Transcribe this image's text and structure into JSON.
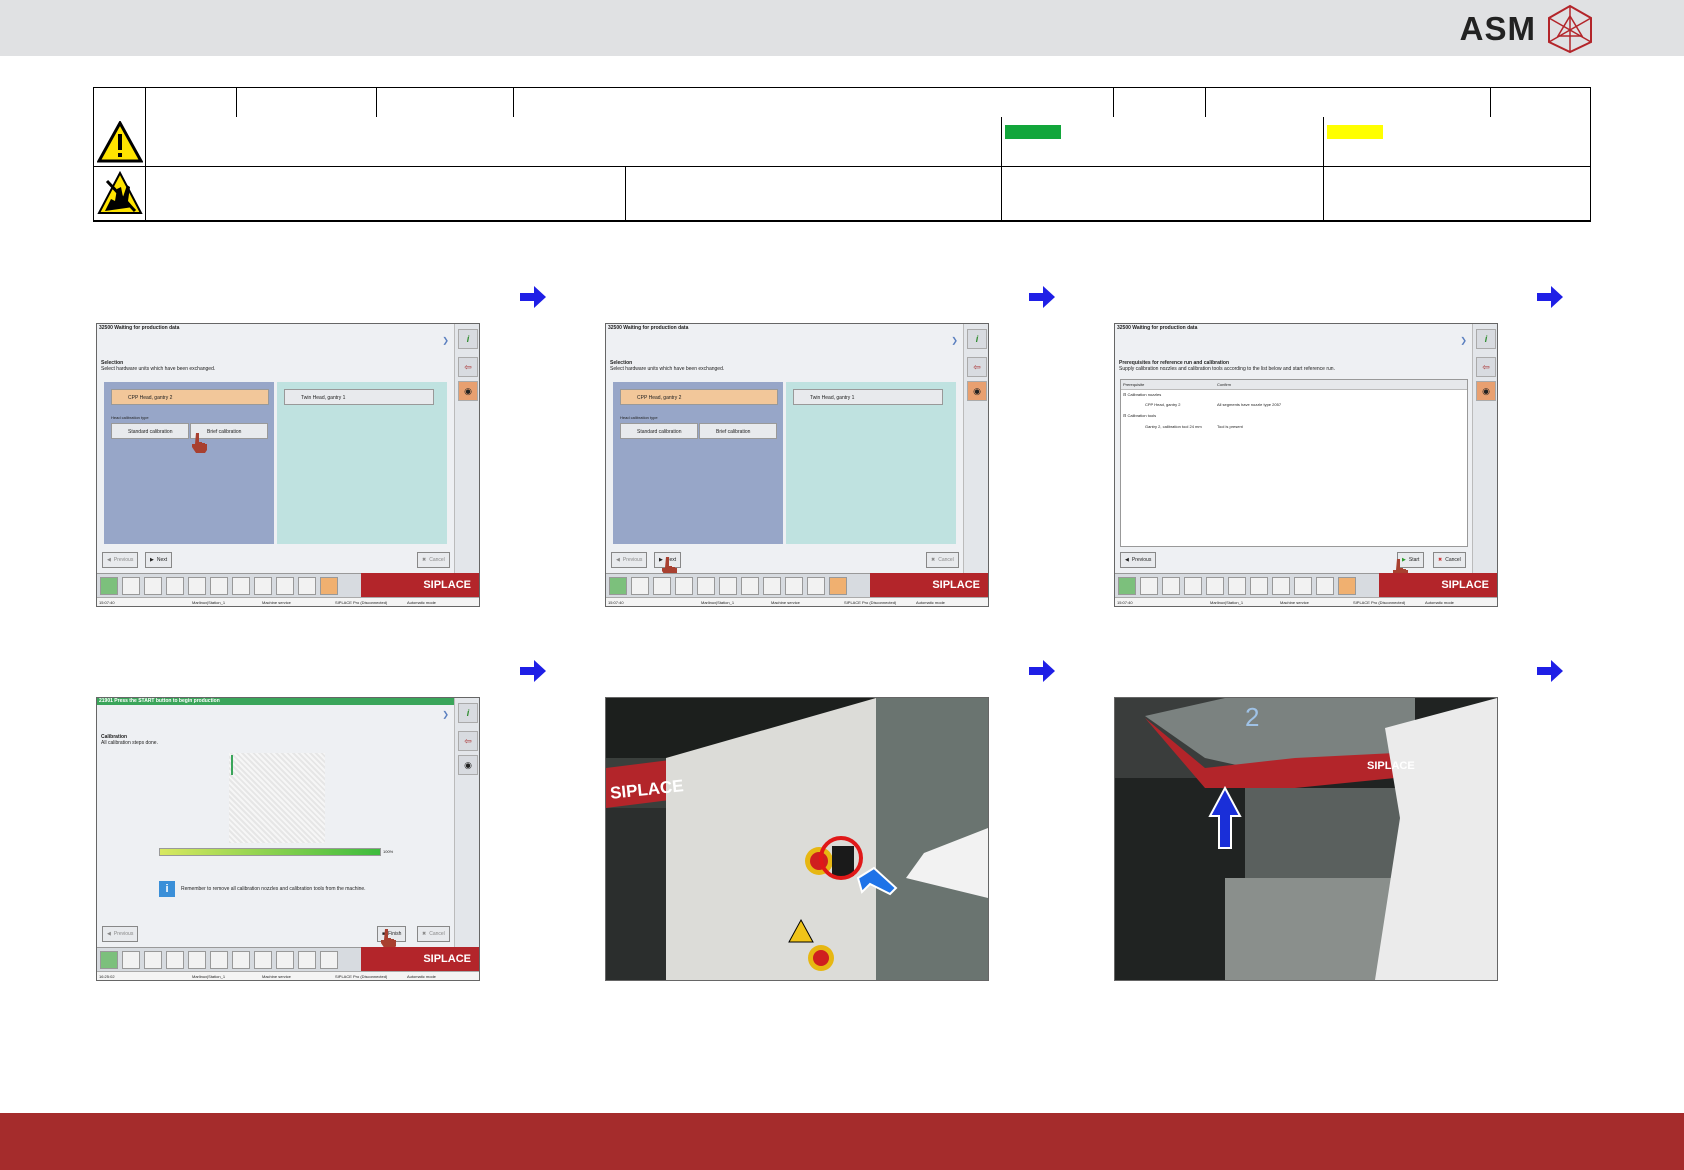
{
  "header": {
    "logo_text": "ASM"
  },
  "colors": {
    "header_bg": "#e0e1e3",
    "footer_bg": "#a52c2c",
    "brand_red": "#b3252a",
    "arrow_blue": "#1f1fe6",
    "swatch_green": "#12a63b",
    "swatch_yellow": "#ffff00"
  },
  "info_table": {
    "warning_icon": "warning-triangle-icon",
    "esd_icon": "esd-hand-icon"
  },
  "screens": {
    "s1": {
      "title": "32500 Waiting for production data",
      "section_title": "Selection",
      "section_text": "Select hardware units which have been exchanged.",
      "left_unit": "CPP Head, gantry 2",
      "right_unit": "Twin Head, gantry 1",
      "calib_label": "Head calibration type",
      "standard": "Standard calibration",
      "brief": "Brief calibration",
      "prev": "Previous",
      "next": "Next",
      "cancel": "Cancel"
    },
    "s3": {
      "title": "32500 Waiting for production data",
      "section_title": "Prerequisites for reference run and calibration",
      "section_text": "Supply calibration nozzles and calibration tools according to the list below and start reference run.",
      "col_prereq": "Prerequisite",
      "col_confirm": "Confirm",
      "group1": "Calibration nozzles",
      "row1_item": "CPP Head, gantry 2",
      "row1_confirm": "All segments have nozzle type 2057",
      "group2": "Calibration tools",
      "row2_item": "Gantry 2, calibration tool 24 mm",
      "row2_confirm": "Tool is present",
      "prev": "Previous",
      "start": "Start",
      "cancel": "Cancel"
    },
    "s4": {
      "title": "21901 Press the START button to begin production",
      "section_title": "Calibration",
      "section_text": "All calibration steps done.",
      "progress": 100,
      "progress_label": "100%",
      "hint": "Remember to remove all calibration nozzles and calibration tools from the machine.",
      "prev": "Previous",
      "finish": "Finish",
      "cancel": "Cancel"
    },
    "brand": "SIPLACE",
    "status": {
      "time1": "15:07:40",
      "time4": "16:25:02",
      "line": "Marlinux|Station_1",
      "service": "Machine service",
      "pro": "SIPLACE Pro (Disconnected)",
      "mode": "Automatic mode"
    }
  },
  "photos": {
    "p5_label": "SIPLACE",
    "p6_label": "SIPLACE",
    "p6_number": "2"
  }
}
